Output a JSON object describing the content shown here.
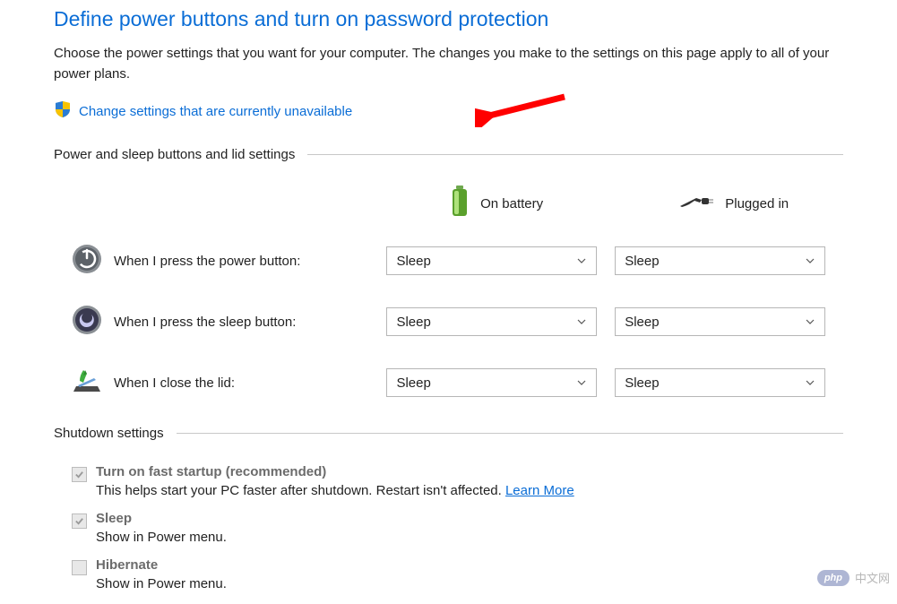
{
  "page": {
    "title": "Define power buttons and turn on password protection",
    "description": "Choose the power settings that you want for your computer. The changes you make to the settings on this page apply to all of your power plans.",
    "change_link": "Change settings that are currently unavailable"
  },
  "sections": {
    "power_sleep_header": "Power and sleep buttons and lid settings",
    "shutdown_header": "Shutdown settings"
  },
  "columns": {
    "battery": "On battery",
    "plugged": "Plugged in"
  },
  "rows": {
    "power_button": {
      "label": "When I press the power button:",
      "battery_value": "Sleep",
      "plugged_value": "Sleep"
    },
    "sleep_button": {
      "label": "When I press the sleep button:",
      "battery_value": "Sleep",
      "plugged_value": "Sleep"
    },
    "close_lid": {
      "label": "When I close the lid:",
      "battery_value": "Sleep",
      "plugged_value": "Sleep"
    }
  },
  "shutdown": {
    "fast_startup": {
      "title": "Turn on fast startup (recommended)",
      "desc_prefix": "This helps start your PC faster after shutdown. Restart isn't affected. ",
      "learn_more": "Learn More",
      "checked": true
    },
    "sleep": {
      "title": "Sleep",
      "desc": "Show in Power menu.",
      "checked": true
    },
    "hibernate": {
      "title": "Hibernate",
      "desc": "Show in Power menu.",
      "checked": false
    }
  },
  "watermark": {
    "badge": "php",
    "text": "中文网"
  }
}
